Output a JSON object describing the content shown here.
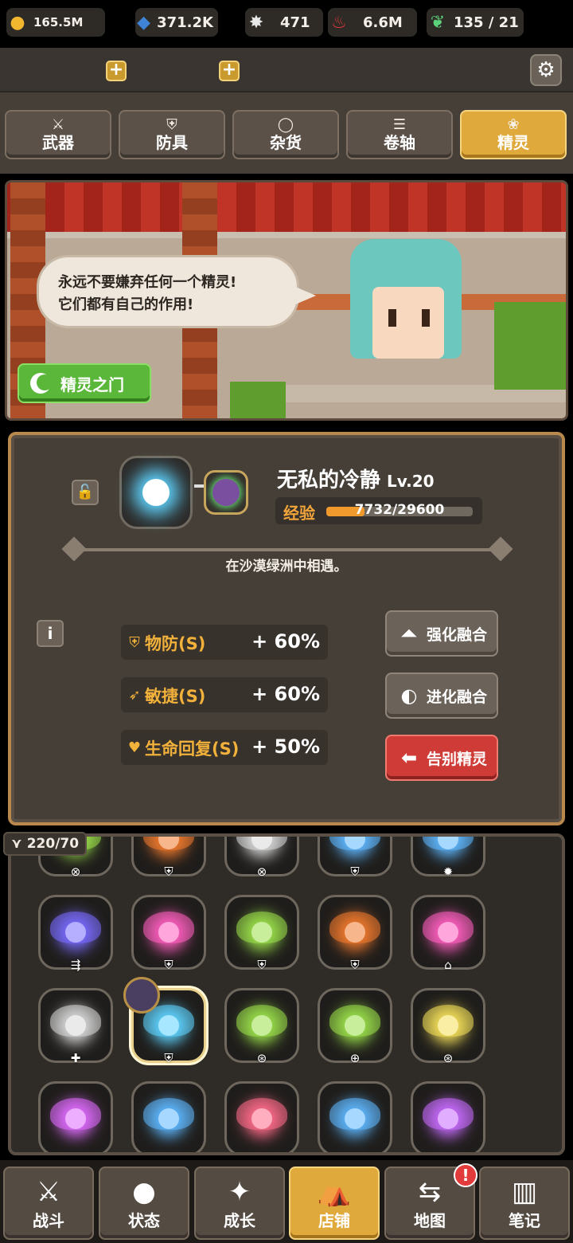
{
  "resources": {
    "gold": "165.5M",
    "crystal": "371.2K",
    "star": "471",
    "flame": "6.6M",
    "leaf": "135 / 21",
    "colors": {
      "gold": "#f2b72e",
      "crystal": "#3f83d6",
      "flame": "#e0373a",
      "leaf": "#5bd17a"
    }
  },
  "tabs": [
    {
      "label": "武器",
      "icon": "sword-icon"
    },
    {
      "label": "防具",
      "icon": "shield-icon"
    },
    {
      "label": "杂货",
      "icon": "ring-icon"
    },
    {
      "label": "卷轴",
      "icon": "scroll-icon"
    },
    {
      "label": "精灵",
      "icon": "wings-icon"
    }
  ],
  "active_tab": "精灵",
  "scene": {
    "speech_line1": "永远不要嫌弃任何一个精灵!",
    "speech_line2": "它们都有自己的作用!",
    "gate_button": "精灵之门"
  },
  "spirit": {
    "name": "无私的冷静",
    "level": "Lv.20",
    "exp_label": "经验",
    "exp_text": "7732/29600",
    "exp_fraction": 0.261,
    "origin": "在沙漠绿洲中相遇。",
    "stats": [
      {
        "name": "物防(S)",
        "value": "+ 60%",
        "icon": "shield-icon"
      },
      {
        "name": "敏捷(S)",
        "value": "+ 60%",
        "icon": "boot-icon"
      },
      {
        "name": "生命回复(S)",
        "value": "+ 50%",
        "icon": "heart-plus-icon"
      }
    ],
    "actions": {
      "enhance": "强化融合",
      "evolve": "进化融合",
      "farewell": "告别精灵"
    }
  },
  "inventory": {
    "count": "220/70",
    "colors": [
      "#9be04a",
      "#f07a2e",
      "#d8d8d8",
      "#5fb8ff",
      "#5fb8ff",
      "#7a6cff",
      "#ff5fc0",
      "#9be04a",
      "#f07a2e",
      "#ff5fc0",
      "#d8d8d8",
      "#5fd4ff",
      "#9be04a",
      "#9be04a",
      "#f4e05a",
      "#e06cff",
      "#5fb8ff",
      "#ff6c8a",
      "#5fb8ff",
      "#c86cff"
    ]
  },
  "nav": [
    {
      "label": "战斗",
      "icon": "crossed-swords-icon"
    },
    {
      "label": "状态",
      "icon": "person-icon"
    },
    {
      "label": "成长",
      "icon": "sparkle-icon"
    },
    {
      "label": "店铺",
      "icon": "tent-icon"
    },
    {
      "label": "地图",
      "icon": "signpost-icon"
    },
    {
      "label": "笔记",
      "icon": "book-icon"
    }
  ],
  "nav_alert": "!"
}
